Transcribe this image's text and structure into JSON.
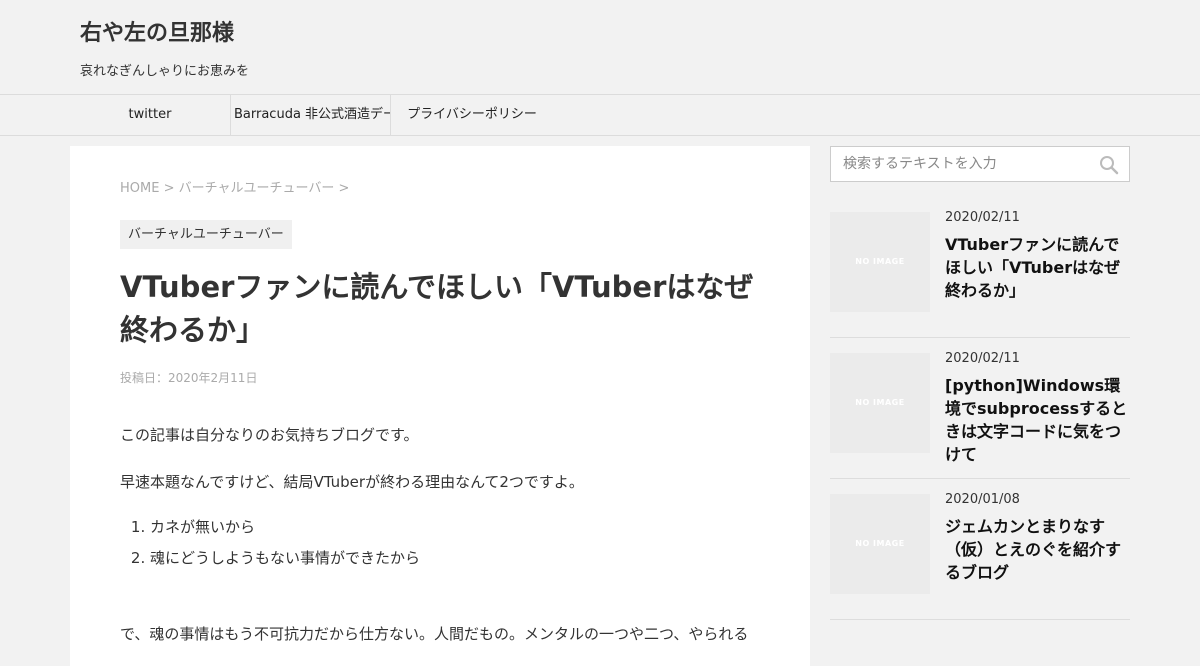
{
  "site": {
    "title": "右や左の旦那様",
    "description": "哀れなぎんしゃりにお恵みを"
  },
  "nav": {
    "items": [
      {
        "label": "twitter"
      },
      {
        "label": "Barracuda 非公式酒造データ"
      },
      {
        "label": "プライバシーポリシー"
      }
    ]
  },
  "breadcrumb": {
    "home": "HOME",
    "sep": ">",
    "category": "バーチャルユーチューバー"
  },
  "post": {
    "category": "バーチャルユーチューバー",
    "title": "VTuberファンに読んでほしい「VTuberはなぜ終わるか」",
    "date": "投稿日：2020年2月11日",
    "paragraphs": [
      "この記事は自分なりのお気持ちブログです。",
      "早速本題なんですけど、結局VTuberが終わる理由なんて2つですよ。",
      "で、魂の事情はもう不可抗力だから仕方ない。人間だもの。メンタルの一つや二つ、やられる"
    ],
    "reasons": [
      "カネが無いから",
      "魂にどうしようもない事情ができたから"
    ]
  },
  "sidebar": {
    "search_placeholder": "検索するテキストを入力",
    "search_icon": "search-icon",
    "no_image_label": "NO IMAGE",
    "recent": [
      {
        "date": "2020/02/11",
        "title": "VTuberファンに読んでほしい「VTuberはなぜ終わるか」"
      },
      {
        "date": "2020/02/11",
        "title": "[python]Windows環境でsubprocessするときは文字コードに気をつけて"
      },
      {
        "date": "2020/01/08",
        "title": "ジェムカンとまりなす（仮）とえのぐを紹介するブログ"
      }
    ]
  }
}
